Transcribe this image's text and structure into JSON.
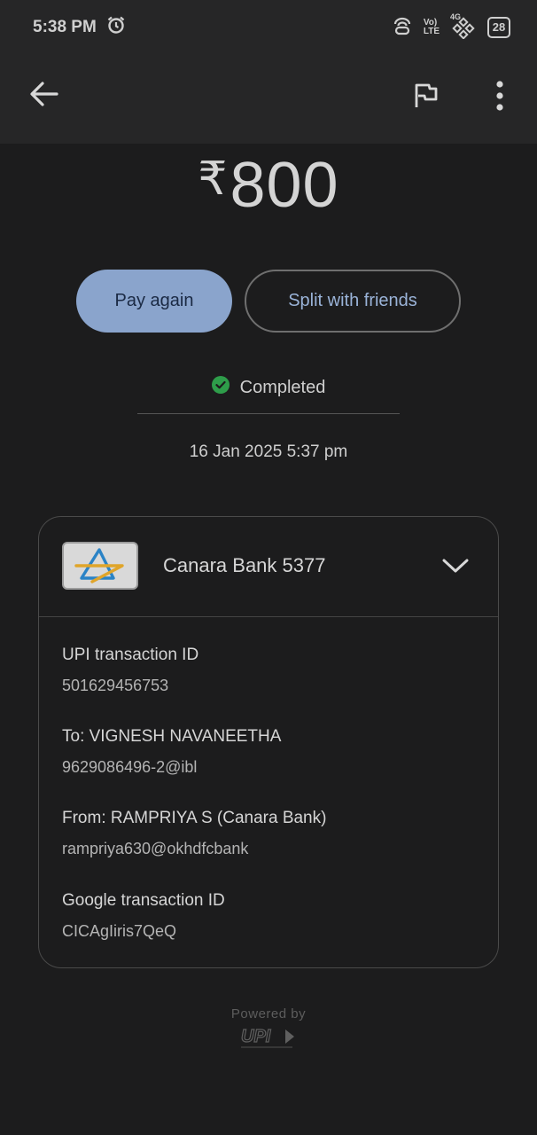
{
  "status_bar": {
    "time": "5:38 PM",
    "network_label_top": "Vo)",
    "network_label_bottom": "LTE",
    "network_type": "4G",
    "battery": "28",
    "icons": [
      "alarm-icon",
      "hotspot-icon",
      "volte-icon",
      "signal-icon",
      "battery-icon"
    ]
  },
  "app_bar": {
    "icons": [
      "back-arrow-icon",
      "flag-icon",
      "more-vert-icon"
    ]
  },
  "payment": {
    "currency_symbol": "₹",
    "amount": "800",
    "pay_again_label": "Pay again",
    "split_label": "Split with friends",
    "status_text": "Completed",
    "status_color": "#2e9d4a",
    "datetime": "16 Jan 2025 5:37 pm"
  },
  "bank_card": {
    "bank_name": "Canara Bank 5377",
    "details": [
      {
        "label": "UPI transaction ID",
        "value": "501629456753"
      },
      {
        "label": "To: VIGNESH NAVANEETHA",
        "value": "9629086496-2@ibl"
      },
      {
        "label": "From: RAMPRIYA  S (Canara Bank)",
        "value": "rampriya630@okhdfcbank"
      },
      {
        "label": "Google transaction ID",
        "value": "CICAgIiris7QeQ"
      }
    ]
  },
  "footer": {
    "powered_by": "Powered by"
  },
  "colors": {
    "background": "#1c1c1d",
    "pay_again_bg": "#8aa4cc",
    "split_text": "#9ab3d8"
  }
}
